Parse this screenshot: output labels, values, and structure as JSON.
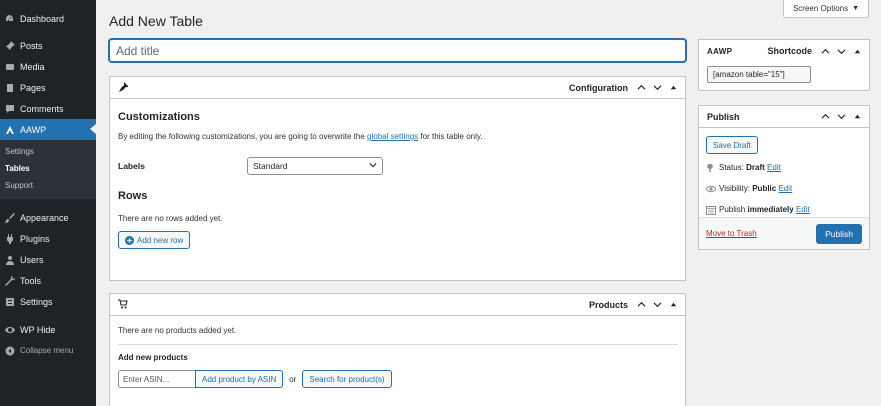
{
  "sidebar": {
    "items_top": [
      {
        "label": "Dashboard",
        "icon": "dashboard-icon"
      },
      {
        "label": "Posts",
        "icon": "pin-icon"
      },
      {
        "label": "Media",
        "icon": "media-icon"
      },
      {
        "label": "Pages",
        "icon": "pages-icon"
      },
      {
        "label": "Comments",
        "icon": "comment-icon"
      },
      {
        "label": "AAWP",
        "icon": "aawp-icon"
      }
    ],
    "submenu": [
      "Settings",
      "Tables",
      "Support"
    ],
    "items_bottom": [
      {
        "label": "Appearance",
        "icon": "brush-icon"
      },
      {
        "label": "Plugins",
        "icon": "plugin-icon"
      },
      {
        "label": "Users",
        "icon": "users-icon"
      },
      {
        "label": "Tools",
        "icon": "wrench-icon"
      },
      {
        "label": "Settings",
        "icon": "settings-icon"
      },
      {
        "label": "WP Hide",
        "icon": "eye-icon"
      },
      {
        "label": "Collapse menu",
        "icon": "collapse-icon"
      }
    ]
  },
  "page": {
    "title": "Add New Table",
    "screen_options": "Screen Options",
    "title_placeholder": "Add title"
  },
  "configuration": {
    "header": "Configuration",
    "customizations_title": "Customizations",
    "intro_before": "By editing the following customizations, you are going to overwrite the ",
    "intro_link": "global settings",
    "intro_after": " for this table only.",
    "labels_label": "Labels",
    "labels_value": "Standard",
    "rows_title": "Rows",
    "rows_empty": "There are no rows added yet.",
    "add_row_button": "Add new row"
  },
  "products": {
    "header": "Products",
    "empty": "There are no products added yet.",
    "add_title": "Add new products",
    "asin_placeholder": "Enter ASIN...",
    "add_by_asin_button": "Add product by ASIN",
    "or": "or",
    "search_button": "Search for product(s)"
  },
  "shortcode_box": {
    "brand": "AAWP",
    "header": "Shortcode",
    "value": "[amazon table=\"15\"]"
  },
  "publish_box": {
    "header": "Publish",
    "save_draft": "Save Draft",
    "status_label": "Status:",
    "status_value": "Draft",
    "visibility_label": "Visibility:",
    "visibility_value": "Public",
    "publish_label": "Publish",
    "publish_value": "immediately",
    "edit": "Edit",
    "trash": "Move to Trash",
    "publish_button": "Publish"
  },
  "colors": {
    "sidebar_bg": "#1d2327",
    "accent": "#2271b1",
    "trash": "#b32d2e"
  }
}
